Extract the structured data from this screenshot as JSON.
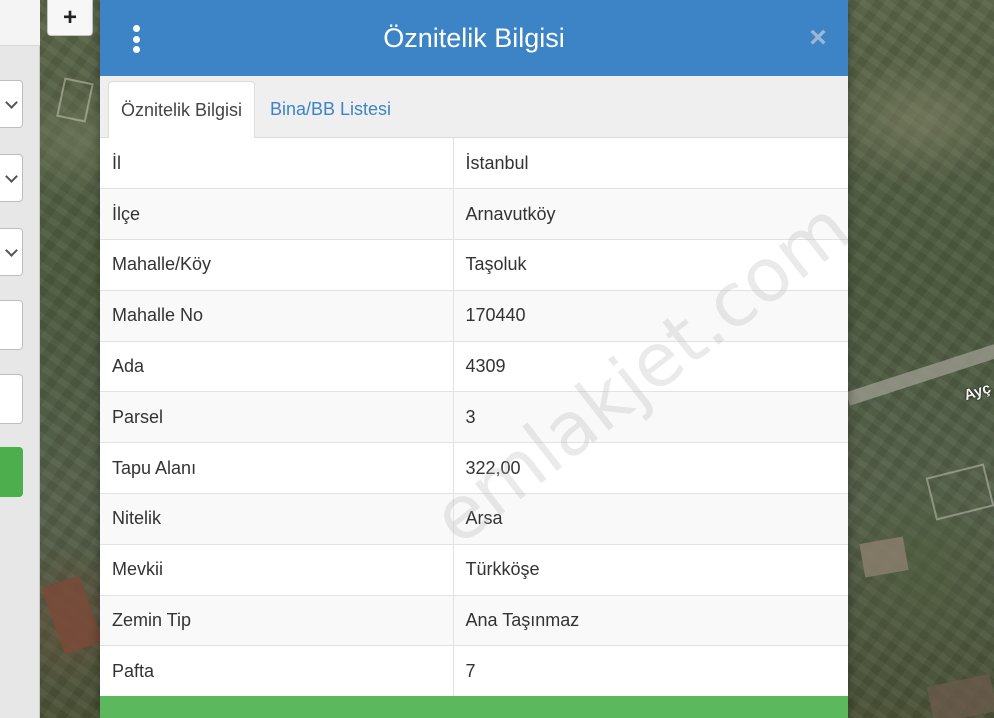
{
  "map": {
    "zoom_in_label": "+",
    "road_label": "Ayç"
  },
  "modal": {
    "title": "Öznitelik Bilgisi",
    "close_label": "×",
    "tabs": [
      {
        "label": "Öznitelik Bilgisi",
        "active": true
      },
      {
        "label": "Bina/BB Listesi",
        "active": false
      }
    ],
    "rows": [
      {
        "key": "İl",
        "value": "İstanbul"
      },
      {
        "key": "İlçe",
        "value": "Arnavutköy"
      },
      {
        "key": "Mahalle/Köy",
        "value": "Taşoluk"
      },
      {
        "key": "Mahalle No",
        "value": "170440"
      },
      {
        "key": "Ada",
        "value": "4309"
      },
      {
        "key": "Parsel",
        "value": "3"
      },
      {
        "key": "Tapu Alanı",
        "value": "322,00"
      },
      {
        "key": "Nitelik",
        "value": "Arsa"
      },
      {
        "key": "Mevkii",
        "value": "Türkköşe"
      },
      {
        "key": "Zemin Tip",
        "value": "Ana Taşınmaz"
      },
      {
        "key": "Pafta",
        "value": "7"
      }
    ]
  },
  "watermark": "emlakjet.com",
  "colors": {
    "header_blue": "#3d84c6",
    "tab_link": "#3d84c6",
    "footer_green": "#5cb85c",
    "left_button_green": "#4cae4c"
  },
  "icons": {
    "menu": "kebab-menu-icon",
    "close": "close-icon",
    "dropdown": "chevron-down-icon"
  }
}
